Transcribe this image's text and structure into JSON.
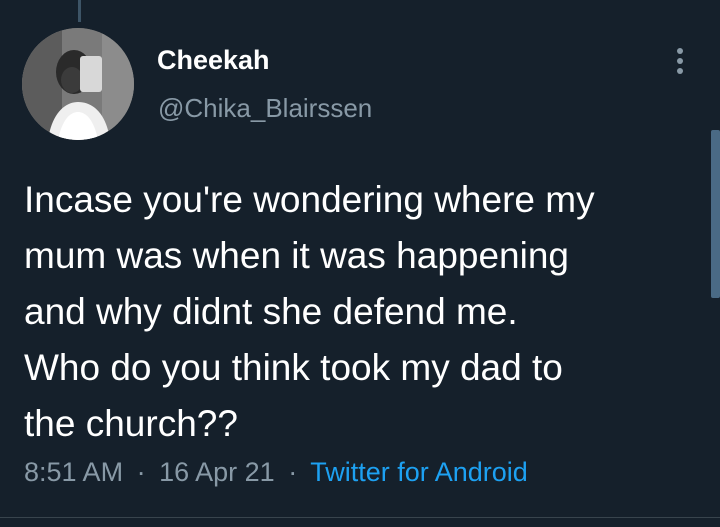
{
  "author": {
    "display_name": "Cheekah",
    "handle": "@Chika_Blairssen",
    "avatar_icon": "profile-photo"
  },
  "tweet": {
    "lines": [
      "Incase you're wondering where my",
      "mum was when it was happening",
      "and why didnt she defend me.",
      "Who do you think took my dad to",
      "the church??"
    ]
  },
  "meta": {
    "time": "8:51 AM",
    "separator": "·",
    "date": "16 Apr 21",
    "source": "Twitter for Android"
  },
  "colors": {
    "background": "#15202b",
    "text": "#ffffff",
    "muted": "#8899a6",
    "link": "#1da1f2"
  },
  "icons": {
    "more": "more-vertical-icon"
  }
}
